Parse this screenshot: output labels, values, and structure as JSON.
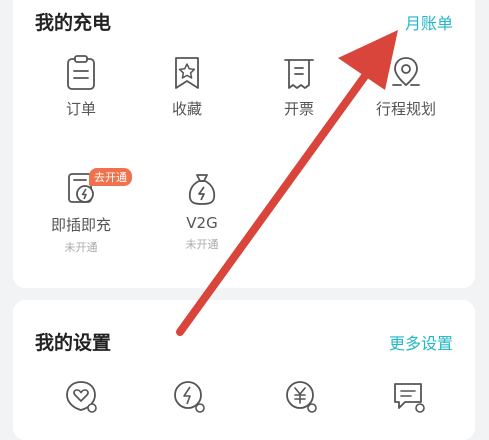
{
  "charging": {
    "title": "我的充电",
    "link": "月账单",
    "items": [
      {
        "label": "订单",
        "icon": "clipboard-icon"
      },
      {
        "label": "收藏",
        "icon": "bookmark-star-icon"
      },
      {
        "label": "开票",
        "icon": "receipt-icon"
      },
      {
        "label": "行程规划",
        "icon": "map-pin-icon"
      },
      {
        "label": "即插即充",
        "sub": "未开通",
        "badge": "去开通",
        "icon": "plug-charge-icon"
      },
      {
        "label": "V2G",
        "sub": "未开通",
        "icon": "money-bag-lightning-icon"
      }
    ]
  },
  "settings": {
    "title": "我的设置",
    "link": "更多设置",
    "icons": [
      "heart-settings-icon",
      "lightning-settings-icon",
      "yuan-settings-icon",
      "message-settings-icon"
    ]
  },
  "annotation": {
    "arrow_color": "#d9443b"
  },
  "colors": {
    "accent": "#21b8c6",
    "badge": "#f0714d",
    "icon_stroke": "#555555"
  }
}
